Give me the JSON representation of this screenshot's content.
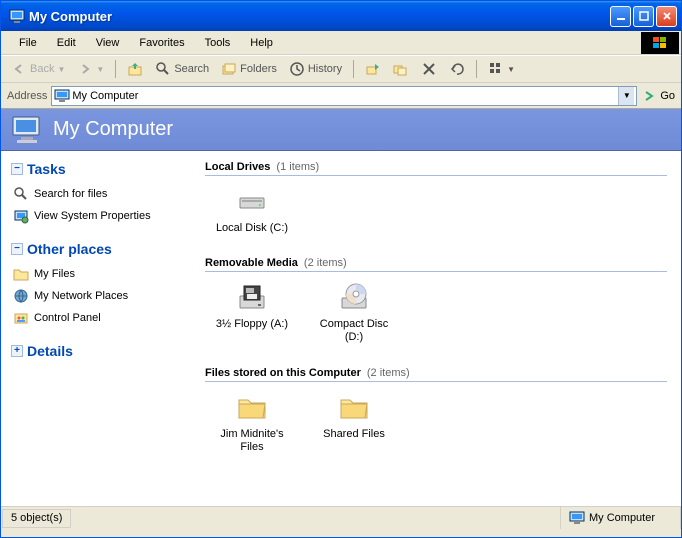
{
  "window": {
    "title": "My Computer"
  },
  "menubar": {
    "items": [
      "File",
      "Edit",
      "View",
      "Favorites",
      "Tools",
      "Help"
    ]
  },
  "toolbar": {
    "back": "Back",
    "search": "Search",
    "folders": "Folders",
    "history": "History"
  },
  "addressbar": {
    "label": "Address",
    "value": "My Computer",
    "go": "Go"
  },
  "banner": {
    "title": "My Computer"
  },
  "sidebar": {
    "sections": [
      {
        "title": "Tasks",
        "items": [
          {
            "label": "Search for files",
            "icon": "search-icon"
          },
          {
            "label": "View System Properties",
            "icon": "properties-icon"
          }
        ]
      },
      {
        "title": "Other places",
        "items": [
          {
            "label": "My Files",
            "icon": "folder-icon"
          },
          {
            "label": "My Network Places",
            "icon": "network-icon"
          },
          {
            "label": "Control Panel",
            "icon": "control-panel-icon"
          }
        ]
      },
      {
        "title": "Details",
        "items": []
      }
    ]
  },
  "main": {
    "groups": [
      {
        "title": "Local Drives",
        "count": "(1 items)",
        "items": [
          {
            "label": "Local Disk (C:)",
            "icon": "hard-drive-icon"
          }
        ]
      },
      {
        "title": "Removable Media",
        "count": "(2 items)",
        "items": [
          {
            "label": "3½ Floppy (A:)",
            "icon": "floppy-icon"
          },
          {
            "label": "Compact Disc (D:)",
            "icon": "cd-icon"
          }
        ]
      },
      {
        "title": "Files stored on this Computer",
        "count": "(2 items)",
        "items": [
          {
            "label": "Jim Midnite's Files",
            "icon": "folder-big-icon"
          },
          {
            "label": "Shared Files",
            "icon": "folder-big-icon"
          }
        ]
      }
    ]
  },
  "statusbar": {
    "object_count": "5 object(s)",
    "location": "My Computer"
  }
}
